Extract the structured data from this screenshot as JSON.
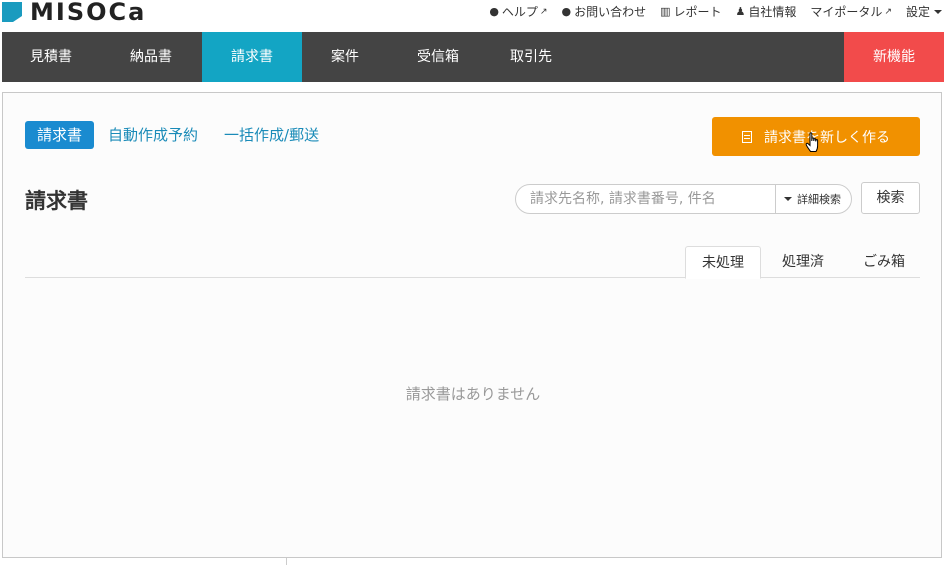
{
  "brand": {
    "logo_text": "MISOCa"
  },
  "toplinks": [
    {
      "icon": "question-circle-icon",
      "glyph": "❓",
      "label": "ヘルプ",
      "external": true
    },
    {
      "icon": "comment-icon",
      "glyph": "💬",
      "label": "お問い合わせ",
      "external": false
    },
    {
      "icon": "bar-chart-icon",
      "glyph": "📊",
      "label": "レポート",
      "external": false
    },
    {
      "icon": "user-icon",
      "glyph": "👤",
      "label": "自社情報",
      "external": false
    },
    {
      "icon": "",
      "glyph": "",
      "label": "マイポータル",
      "external": true
    },
    {
      "icon": "",
      "glyph": "",
      "label": "設定",
      "external": false,
      "dropdown": true
    }
  ],
  "nav": {
    "items": [
      "見積書",
      "納品書",
      "請求書",
      "案件",
      "受信箱",
      "取引先"
    ],
    "active_index": 2,
    "new_feature": "新機能"
  },
  "subtabs": {
    "items": [
      "請求書",
      "自動作成予約",
      "一括作成/郵送"
    ],
    "active_index": 0
  },
  "create_button": {
    "label": "請求書を新しく作る"
  },
  "page_title": "請求書",
  "search": {
    "placeholder": "請求先名称, 請求書番号, 件名",
    "detail_label": "詳細検索",
    "button_label": "検索"
  },
  "status_tabs": {
    "items": [
      "未処理",
      "処理済",
      "ごみ箱"
    ],
    "active_index": 0
  },
  "empty_message": "請求書はありません",
  "colors": {
    "nav_bg": "#444444",
    "nav_active": "#13a5c4",
    "new_feature_bg": "#f24b4b",
    "primary_button": "#f19100",
    "link": "#1a8bb8",
    "logo_mark": "#1a9bbf"
  }
}
